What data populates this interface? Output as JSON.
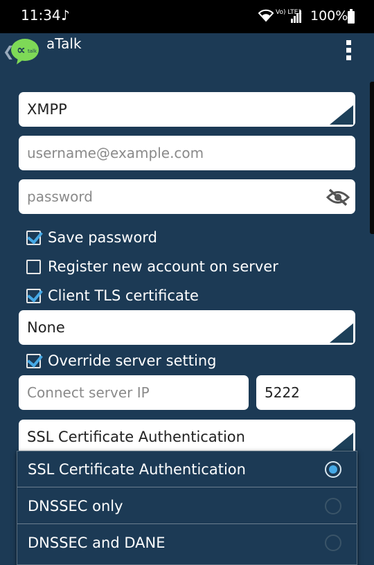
{
  "status_bar": {
    "time": "11:34",
    "music_glyph": "♪",
    "network_label": "Vo) LTE1",
    "battery": "100%"
  },
  "app_bar": {
    "title": "aTalk",
    "logo_text": "ᆨ"
  },
  "form": {
    "account_type": "XMPP",
    "username_placeholder": "username@example.com",
    "password_placeholder": "password",
    "save_password": {
      "label": "Save password",
      "checked": true
    },
    "register_account": {
      "label": "Register new account on server",
      "checked": false
    },
    "client_tls": {
      "label": "Client TLS certificate",
      "checked": true
    },
    "tls_cert_value": "None",
    "override_server": {
      "label": "Override server setting",
      "checked": true
    },
    "server_ip_placeholder": "Connect server IP",
    "port_value": "5222",
    "cert_verification_value": "SSL Certificate Authentication"
  },
  "dropdown": {
    "options": [
      {
        "label": "SSL Certificate Authentication",
        "selected": true
      },
      {
        "label": "DNSSEC only",
        "selected": false
      },
      {
        "label": "DNSSEC and DANE",
        "selected": false
      }
    ]
  },
  "colors": {
    "background": "#1c3a55",
    "accent": "#46a9e6",
    "logo_green": "#7ed957"
  }
}
